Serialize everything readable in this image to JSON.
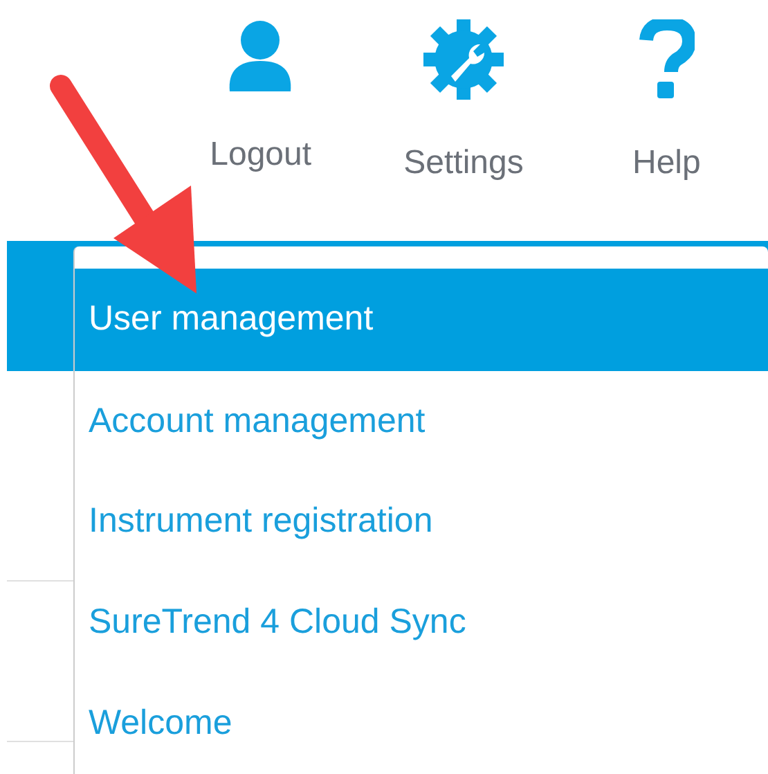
{
  "toolbar": [
    {
      "kind": "user",
      "label": "Logout"
    },
    {
      "kind": "settings",
      "label": "Settings"
    },
    {
      "kind": "help",
      "label": "Help"
    }
  ],
  "menu": {
    "items": [
      {
        "label": "User management",
        "selected": true
      },
      {
        "label": "Account management",
        "selected": false
      },
      {
        "label": "Instrument registration",
        "selected": false
      },
      {
        "label": "SureTrend 4 Cloud Sync",
        "selected": false
      },
      {
        "label": "Welcome",
        "selected": false
      }
    ]
  }
}
